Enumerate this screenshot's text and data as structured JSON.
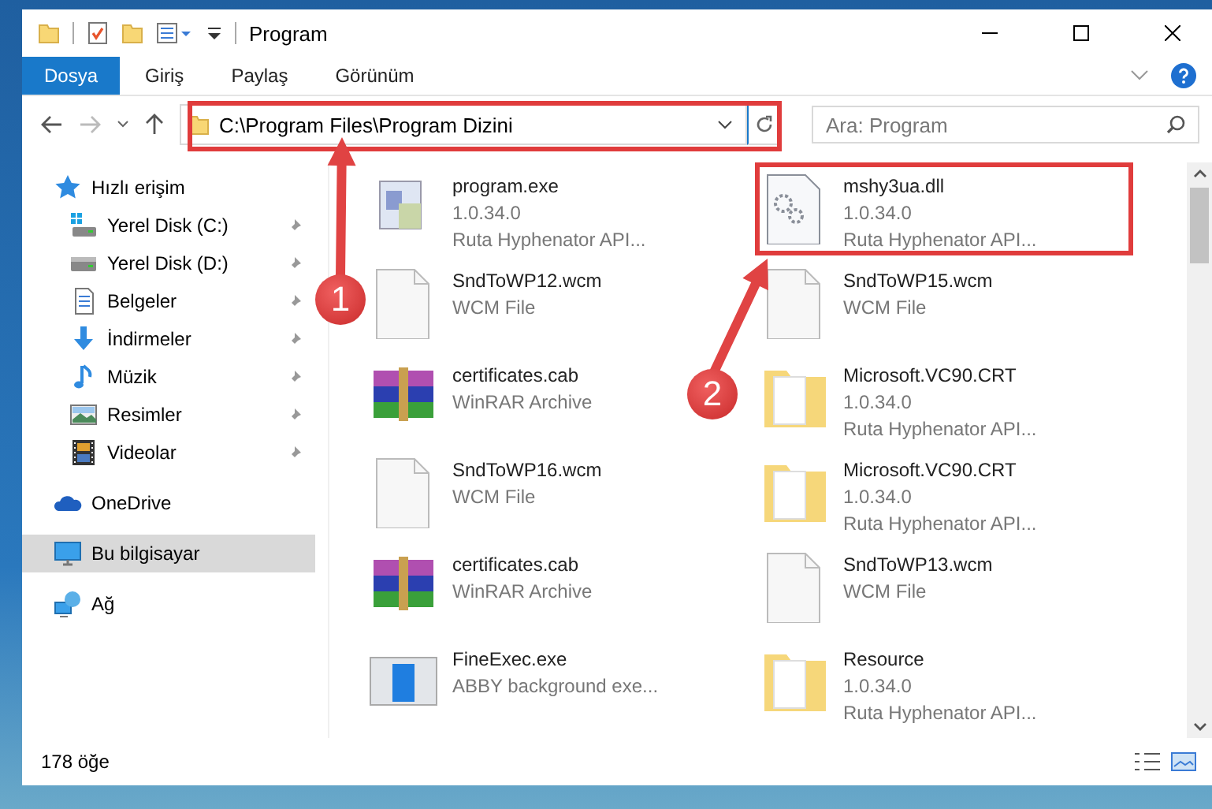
{
  "window": {
    "title": "Program"
  },
  "ribbon_tabs": [
    {
      "label": "Dosya",
      "selected": true
    },
    {
      "label": "Giriş",
      "selected": false
    },
    {
      "label": "Paylaş",
      "selected": false
    },
    {
      "label": "Görünüm",
      "selected": false
    }
  ],
  "address_bar": {
    "value": "C:\\Program Files\\Program Dizini"
  },
  "search": {
    "placeholder": "Ara: Program"
  },
  "sidebar": {
    "items": [
      {
        "label": "Hızlı erişim",
        "selected": false,
        "children": [
          {
            "label": "Yerel Disk (C:)",
            "pinned": true,
            "selected": false
          },
          {
            "label": "Yerel Disk (D:)",
            "pinned": true,
            "selected": false
          },
          {
            "label": "Belgeler",
            "pinned": true,
            "selected": false
          },
          {
            "label": "İndirmeler",
            "pinned": true,
            "selected": false
          },
          {
            "label": "Müzik",
            "pinned": true,
            "selected": false
          },
          {
            "label": "Resimler",
            "pinned": true,
            "selected": false
          },
          {
            "label": "Videolar",
            "pinned": true,
            "selected": false
          }
        ]
      },
      {
        "label": "OneDrive",
        "selected": false
      },
      {
        "label": "Bu bilgisayar",
        "selected": true
      },
      {
        "label": "Ağ",
        "selected": false
      }
    ]
  },
  "files": [
    {
      "name": "program.exe",
      "details": [
        "1.0.34.0",
        "Ruta Hyphenator API..."
      ],
      "kind": "exe"
    },
    {
      "name": "mshy3ua.dll",
      "details": [
        "1.0.34.0",
        "Ruta Hyphenator API..."
      ],
      "kind": "dll"
    },
    {
      "name": "SndToWP12.wcm",
      "details": [
        "WCM File"
      ],
      "kind": "doc"
    },
    {
      "name": "SndToWP15.wcm",
      "details": [
        "WCM File"
      ],
      "kind": "doc"
    },
    {
      "name": "certificates.cab",
      "details": [
        "WinRAR Archive"
      ],
      "kind": "archive"
    },
    {
      "name": "Microsoft.VC90.CRT",
      "details": [
        "1.0.34.0",
        "Ruta Hyphenator API..."
      ],
      "kind": "folder"
    },
    {
      "name": "SndToWP16.wcm",
      "details": [
        "WCM File"
      ],
      "kind": "doc"
    },
    {
      "name": "Microsoft.VC90.CRT",
      "details": [
        "1.0.34.0",
        "Ruta Hyphenator API..."
      ],
      "kind": "folder"
    },
    {
      "name": "certificates.cab",
      "details": [
        "WinRAR Archive"
      ],
      "kind": "archive"
    },
    {
      "name": "SndToWP13.wcm",
      "details": [
        "WCM File"
      ],
      "kind": "doc"
    },
    {
      "name": "FineExec.exe",
      "details": [
        "ABBY background exe..."
      ],
      "kind": "app"
    },
    {
      "name": "Resource",
      "details": [
        "1.0.34.0",
        "Ruta Hyphenator API..."
      ],
      "kind": "folder"
    }
  ],
  "status_bar": {
    "count": "178 öğe"
  },
  "annotations": [
    {
      "number": "1"
    },
    {
      "number": "2"
    }
  ]
}
